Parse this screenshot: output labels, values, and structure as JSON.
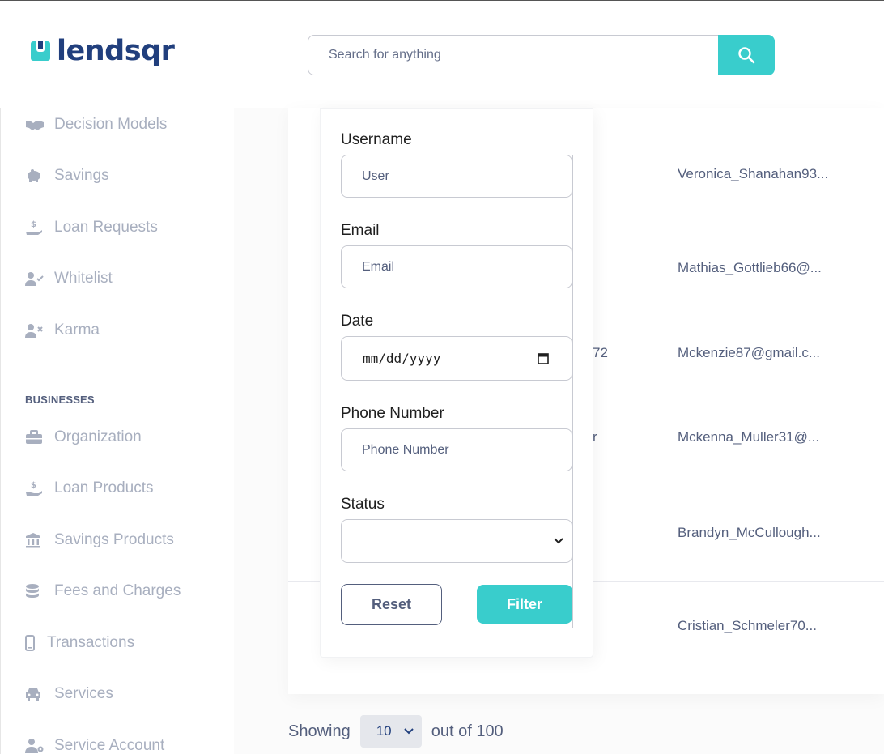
{
  "brand": {
    "name": "lendsqr"
  },
  "search": {
    "placeholder": "Search for anything"
  },
  "sidebar": {
    "items_top": [
      {
        "label": "Decision Models",
        "icon": "handshake-icon"
      },
      {
        "label": "Savings",
        "icon": "piggy-bank-icon"
      },
      {
        "label": "Loan Requests",
        "icon": "hand-coin-icon"
      },
      {
        "label": "Whitelist",
        "icon": "user-check-icon"
      },
      {
        "label": "Karma",
        "icon": "user-x-icon"
      }
    ],
    "section_businesses": "BUSINESSES",
    "items_businesses": [
      {
        "label": "Organization",
        "icon": "briefcase-icon"
      },
      {
        "label": "Loan Products",
        "icon": "hand-coin-icon"
      },
      {
        "label": "Savings Products",
        "icon": "bank-icon"
      },
      {
        "label": "Fees and Charges",
        "icon": "coins-icon"
      },
      {
        "label": "Transactions",
        "icon": "phone-icon"
      },
      {
        "label": "Services",
        "icon": "car-icon"
      },
      {
        "label": "Service Account",
        "icon": "user-gear-icon"
      }
    ]
  },
  "table": {
    "rows": [
      {
        "partial": "",
        "email": "Veronica_Shanahan93..."
      },
      {
        "partial": "",
        "email": "Mathias_Gottlieb66@..."
      },
      {
        "partial": "72",
        "email": "Mckenzie87@gmail.c..."
      },
      {
        "partial": "r",
        "email": "Mckenna_Muller31@..."
      },
      {
        "partial": "",
        "email": "Brandyn_McCullough..."
      },
      {
        "partial": "",
        "email": "Cristian_Schmeler70..."
      }
    ]
  },
  "filter": {
    "username_label": "Username",
    "username_placeholder": "User",
    "email_label": "Email",
    "email_placeholder": "Email",
    "date_label": "Date",
    "date_placeholder": "mm/dd/yyyy",
    "phone_label": "Phone Number",
    "phone_placeholder": "Phone Number",
    "status_label": "Status",
    "status_value": "",
    "reset_label": "Reset",
    "filter_label": "Filter"
  },
  "pagination": {
    "showing_label": "Showing",
    "page_size": "10",
    "out_of_label": "out of 100"
  },
  "colors": {
    "accent": "#39cdcc",
    "brand_navy": "#213f7d",
    "text_muted": "#545f7d",
    "nav_text": "#a8afbf"
  }
}
